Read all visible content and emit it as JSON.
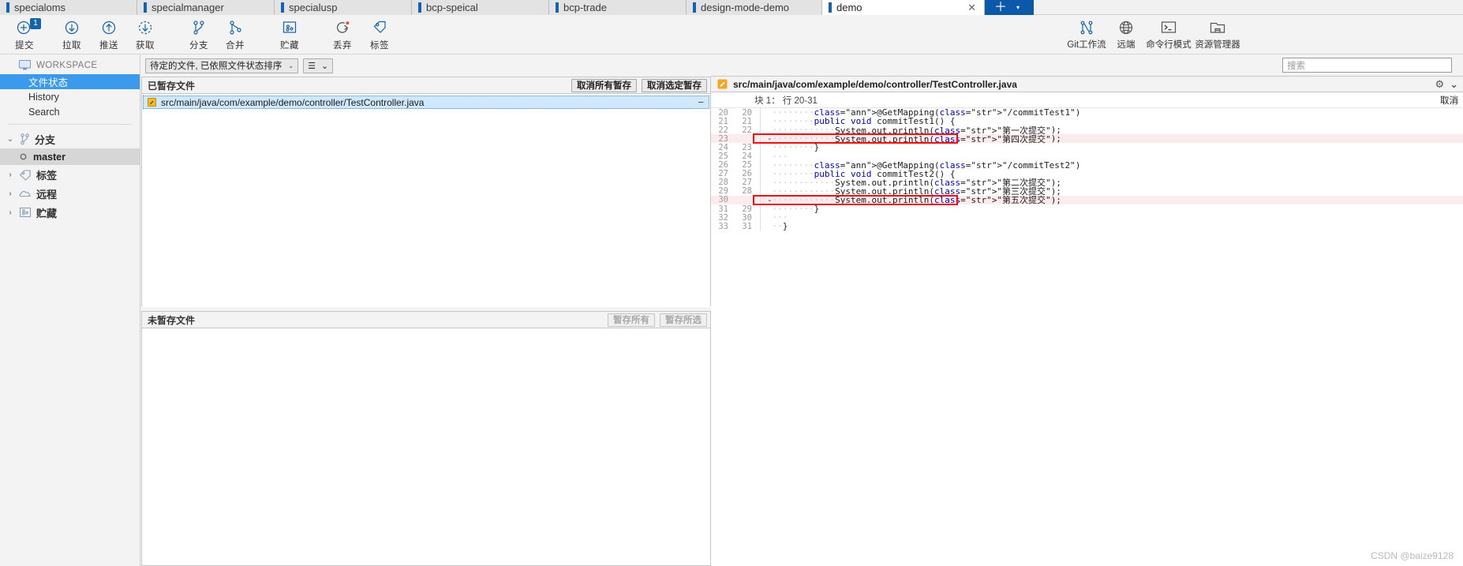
{
  "tabs": [
    {
      "label": "specialoms",
      "active": false
    },
    {
      "label": "specialmanager",
      "active": false
    },
    {
      "label": "specialusp",
      "active": false
    },
    {
      "label": "bcp-speical",
      "active": false
    },
    {
      "label": "bcp-trade",
      "active": false
    },
    {
      "label": "design-mode-demo",
      "active": false
    },
    {
      "label": "demo",
      "active": true
    }
  ],
  "tab_close_label": "✕",
  "tab_add": {
    "plus": "＋",
    "caret": "▾"
  },
  "toolbar": {
    "items": [
      {
        "name": "commit",
        "label": "提交",
        "badge": "1"
      },
      {
        "name": "pull",
        "label": "拉取",
        "badge": ""
      },
      {
        "name": "push",
        "label": "推送",
        "badge": ""
      },
      {
        "name": "fetch",
        "label": "获取",
        "badge": ""
      },
      {
        "name": "branch",
        "label": "分支",
        "badge": ""
      },
      {
        "name": "merge",
        "label": "合并",
        "badge": ""
      },
      {
        "name": "stash",
        "label": "贮藏",
        "badge": ""
      },
      {
        "name": "discard",
        "label": "丢弃",
        "badge": ""
      },
      {
        "name": "tag",
        "label": "标签",
        "badge": ""
      }
    ],
    "right_items": [
      {
        "name": "git-flow",
        "label": "Git工作流"
      },
      {
        "name": "remote",
        "label": "远端"
      },
      {
        "name": "terminal",
        "label": "命令行模式"
      },
      {
        "name": "explorer",
        "label": "资源管理器"
      }
    ]
  },
  "sidebar": {
    "workspace_label": "WORKSPACE",
    "workspace_items": [
      {
        "label": "文件状态",
        "selected": true
      },
      {
        "label": "History",
        "selected": false
      },
      {
        "label": "Search",
        "selected": false
      }
    ],
    "groups": [
      {
        "label": "分支",
        "expanded": true,
        "arrow": "⌄"
      },
      {
        "label": "标签",
        "expanded": false,
        "arrow": "›"
      },
      {
        "label": "远程",
        "expanded": false,
        "arrow": "›"
      },
      {
        "label": "贮藏",
        "expanded": false,
        "arrow": "›"
      }
    ],
    "branch": "master"
  },
  "filterbar": {
    "sort_value": "待定的文件, 已依照文件状态排序",
    "caret": "⌄",
    "view_icon": "☰"
  },
  "staged": {
    "title": "已暂存文件",
    "unstage_all_label": "取消所有暂存",
    "unstage_selected_label": "取消选定暂存",
    "files": [
      {
        "path": "src/main/java/com/example/demo/controller/TestController.java",
        "status": "M",
        "action": "−"
      }
    ]
  },
  "unstaged": {
    "title": "未暂存文件",
    "stage_all_label": "暂存所有",
    "stage_selected_label": "暂存所选",
    "files": []
  },
  "search": {
    "placeholder": "搜索",
    "value": ""
  },
  "diff": {
    "file_path": "src/main/java/com/example/demo/controller/TestController.java",
    "status_icon": "M",
    "hunk_label": "块 1： 行 20-31",
    "cancel_label": "取消",
    "gear": "⚙",
    "caret": "⌄",
    "lines": [
      {
        "old": "20",
        "new": "20",
        "kind": "ctx",
        "indent": "········",
        "code": "@GetMapping(\"/commitTest1\")"
      },
      {
        "old": "21",
        "new": "21",
        "kind": "ctx",
        "indent": "········",
        "code": "public void commitTest1() {"
      },
      {
        "old": "22",
        "new": "22",
        "kind": "ctx",
        "indent": "············",
        "code": "System.out.println(\"第一次提交\");"
      },
      {
        "old": "23",
        "new": "",
        "kind": "del",
        "indent": "············",
        "code": "System.out.println(\"第四次提交\");"
      },
      {
        "old": "24",
        "new": "23",
        "kind": "ctx",
        "indent": "········",
        "code": "}"
      },
      {
        "old": "25",
        "new": "24",
        "kind": "ctx",
        "indent": "···",
        "code": ""
      },
      {
        "old": "26",
        "new": "25",
        "kind": "ctx",
        "indent": "········",
        "code": "@GetMapping(\"/commitTest2\")"
      },
      {
        "old": "27",
        "new": "26",
        "kind": "ctx",
        "indent": "········",
        "code": "public void commitTest2() {"
      },
      {
        "old": "28",
        "new": "27",
        "kind": "ctx",
        "indent": "············",
        "code": "System.out.println(\"第二次提交\");"
      },
      {
        "old": "29",
        "new": "28",
        "kind": "ctx",
        "indent": "············",
        "code": "System.out.println(\"第三次提交\");"
      },
      {
        "old": "30",
        "new": "",
        "kind": "del",
        "indent": "············",
        "code": "System.out.println(\"第五次提交\");"
      },
      {
        "old": "31",
        "new": "29",
        "kind": "ctx",
        "indent": "········",
        "code": "}"
      },
      {
        "old": "32",
        "new": "30",
        "kind": "ctx",
        "indent": "···",
        "code": ""
      },
      {
        "old": "33",
        "new": "31",
        "kind": "ctx",
        "indent": "··",
        "code": "}"
      }
    ]
  },
  "watermark": "CSDN @baize9128",
  "colors": {
    "accent": "#0b59a8",
    "selection": "#3c9aee",
    "delete_bg": "#fdeced",
    "highlight_border": "#ee1111"
  }
}
